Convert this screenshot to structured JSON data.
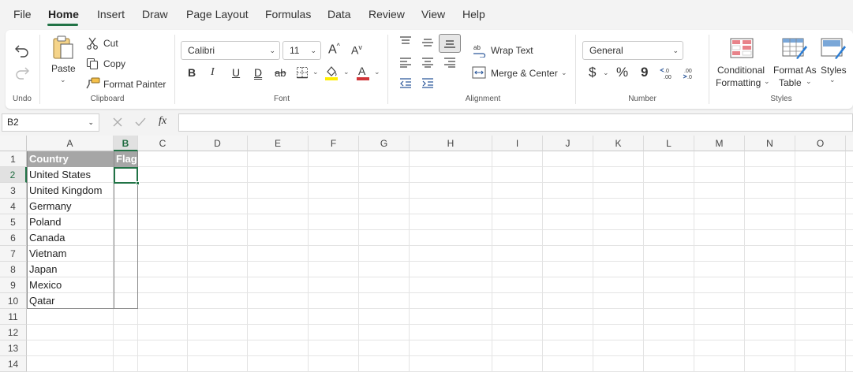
{
  "menu": {
    "items": [
      "File",
      "Home",
      "Insert",
      "Draw",
      "Page Layout",
      "Formulas",
      "Data",
      "Review",
      "View",
      "Help"
    ],
    "active": "Home"
  },
  "ribbon": {
    "undo": {
      "group_label": "Undo"
    },
    "clipboard": {
      "paste": "Paste",
      "cut": "Cut",
      "copy": "Copy",
      "format_painter": "Format Painter",
      "group_label": "Clipboard"
    },
    "font": {
      "font_name": "Calibri",
      "font_size": "11",
      "bold": "B",
      "italic": "I",
      "underline": "U",
      "double_underline": "D",
      "strikethrough": "ab",
      "group_label": "Font",
      "fill_color": "#ffee00",
      "font_color": "#d13438"
    },
    "alignment": {
      "wrap_text": "Wrap Text",
      "merge_center": "Merge & Center",
      "group_label": "Alignment"
    },
    "number": {
      "format": "General",
      "currency": "$",
      "percent": "%",
      "comma": "9",
      "group_label": "Number"
    },
    "styles": {
      "conditional_line1": "Conditional",
      "conditional_line2": "Formatting",
      "format_as_line1": "Format As",
      "format_as_line2": "Table",
      "styles": "Styles",
      "group_label": "Styles"
    }
  },
  "formula_bar": {
    "name_box": "B2",
    "fx": "fx",
    "value": ""
  },
  "grid": {
    "columns": [
      "A",
      "B",
      "C",
      "D",
      "E",
      "F",
      "G",
      "H",
      "I",
      "J",
      "K",
      "L",
      "M",
      "N",
      "O"
    ],
    "rows": [
      "1",
      "2",
      "3",
      "4",
      "5",
      "6",
      "7",
      "8",
      "9",
      "10",
      "11",
      "12",
      "13",
      "14"
    ],
    "selected_column": "B",
    "selected_row": "2",
    "table": {
      "headers": [
        "Country",
        "Flag"
      ],
      "countries": [
        "United States",
        "United Kingdom",
        "Germany",
        "Poland",
        "Canada",
        "Vietnam",
        "Japan",
        "Mexico",
        "Qatar"
      ]
    }
  },
  "colors": {
    "accent": "#217346",
    "table_header_bg": "#a6a6a6"
  }
}
